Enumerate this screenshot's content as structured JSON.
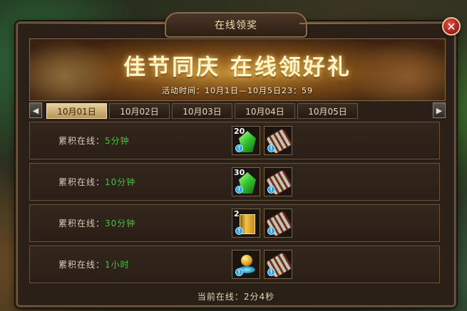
{
  "window": {
    "title": "在线领奖",
    "close_glyph": "✕"
  },
  "banner": {
    "title": "佳节同庆 在线领好礼",
    "time": "活动时间：10月1日—10月5日23：59"
  },
  "nav": {
    "prev_glyph": "◀",
    "next_glyph": "▶"
  },
  "tabs": [
    {
      "label": "10月01日",
      "active": true
    },
    {
      "label": "10月02日",
      "active": false
    },
    {
      "label": "10月03日",
      "active": false
    },
    {
      "label": "10月04日",
      "active": false
    },
    {
      "label": "10月05日",
      "active": false
    }
  ],
  "rows": [
    {
      "prefix": "累积在线：",
      "duration": "5分钟",
      "items": [
        {
          "icon": "green-gem-icon",
          "count": "20"
        },
        {
          "icon": "scroll-icon",
          "count": ""
        }
      ]
    },
    {
      "prefix": "累积在线：",
      "duration": "10分钟",
      "items": [
        {
          "icon": "green-gem-icon",
          "count": "30"
        },
        {
          "icon": "scroll-icon",
          "count": ""
        }
      ]
    },
    {
      "prefix": "累积在线：",
      "duration": "30分钟",
      "items": [
        {
          "icon": "gold-book-icon",
          "count": "2"
        },
        {
          "icon": "scroll-icon",
          "count": ""
        }
      ]
    },
    {
      "prefix": "累积在线：",
      "duration": "1小时",
      "items": [
        {
          "icon": "golden-orb-icon",
          "count": ""
        },
        {
          "icon": "scroll-icon",
          "count": ""
        }
      ]
    }
  ],
  "footer": {
    "text": "当前在线：2分4秒"
  },
  "colors": {
    "duration_green": "#3fc73a",
    "active_tab": "#e6cf9c",
    "info_badge": "#2fa7e4"
  }
}
